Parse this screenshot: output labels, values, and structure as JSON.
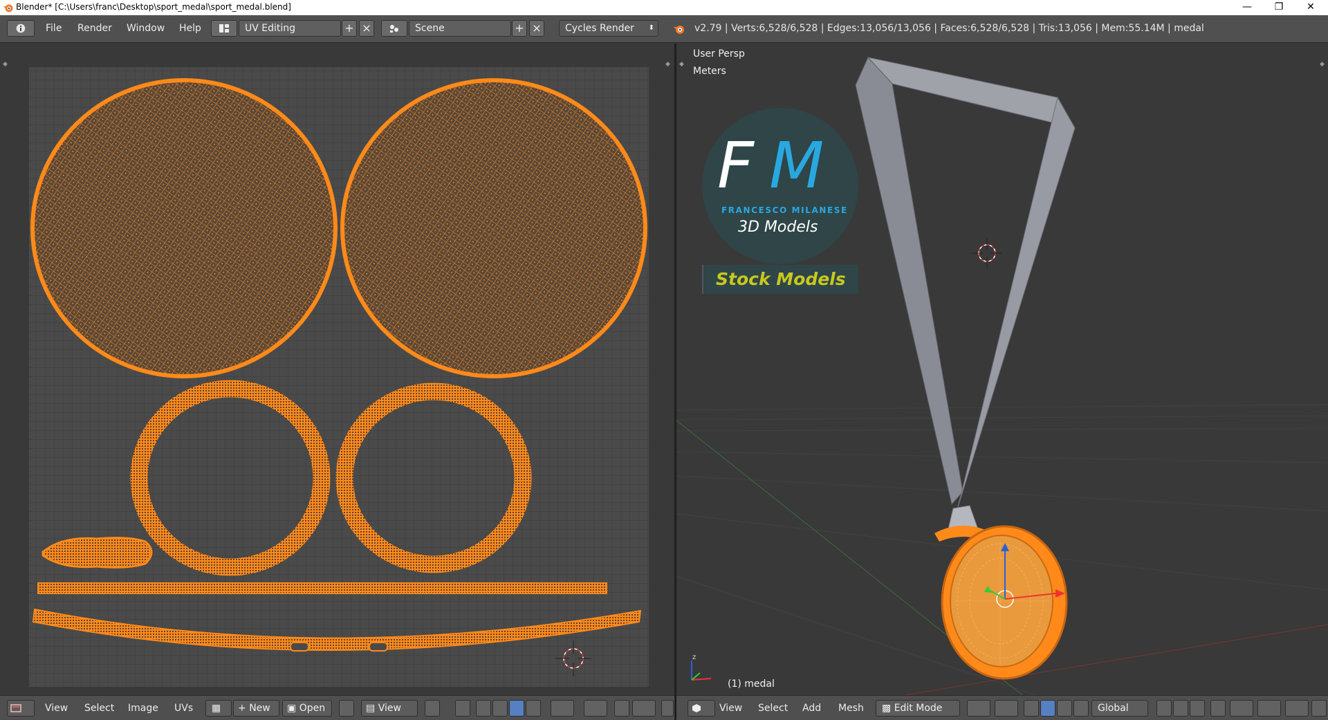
{
  "window": {
    "title": "Blender* [C:\\Users\\franc\\Desktop\\sport_medal\\sport_medal.blend]",
    "minimize": "—",
    "restore": "❐",
    "close": "✕"
  },
  "menu": [
    "File",
    "Render",
    "Window",
    "Help"
  ],
  "screen_layout": "UV Editing",
  "scene": "Scene",
  "render_engine": "Cycles Render",
  "stats": "v2.79 | Verts:6,528/6,528 | Edges:13,056/13,056 | Faces:6,528/6,528 | Tris:13,056 | Mem:55.14M | medal",
  "uv_editor": {
    "menu": [
      "View",
      "Select",
      "Image",
      "UVs"
    ],
    "new_label": "New",
    "open_label": "Open",
    "view_label": "View"
  },
  "viewport": {
    "view_name": "User Persp",
    "units": "Meters",
    "object_label": "(1) medal",
    "menu": [
      "View",
      "Select",
      "Add",
      "Mesh"
    ],
    "mode": "Edit Mode",
    "orientation": "Global"
  },
  "logo": {
    "initials_f": "F",
    "initials_m": "M",
    "name": "FRANCESCO MILANESE",
    "subtitle": "3D Models",
    "banner": "Stock Models"
  },
  "colors": {
    "uv_orange": "#ff8a1a",
    "accent_blue": "#29a8e0",
    "banner_yellow": "#c8c81e"
  }
}
